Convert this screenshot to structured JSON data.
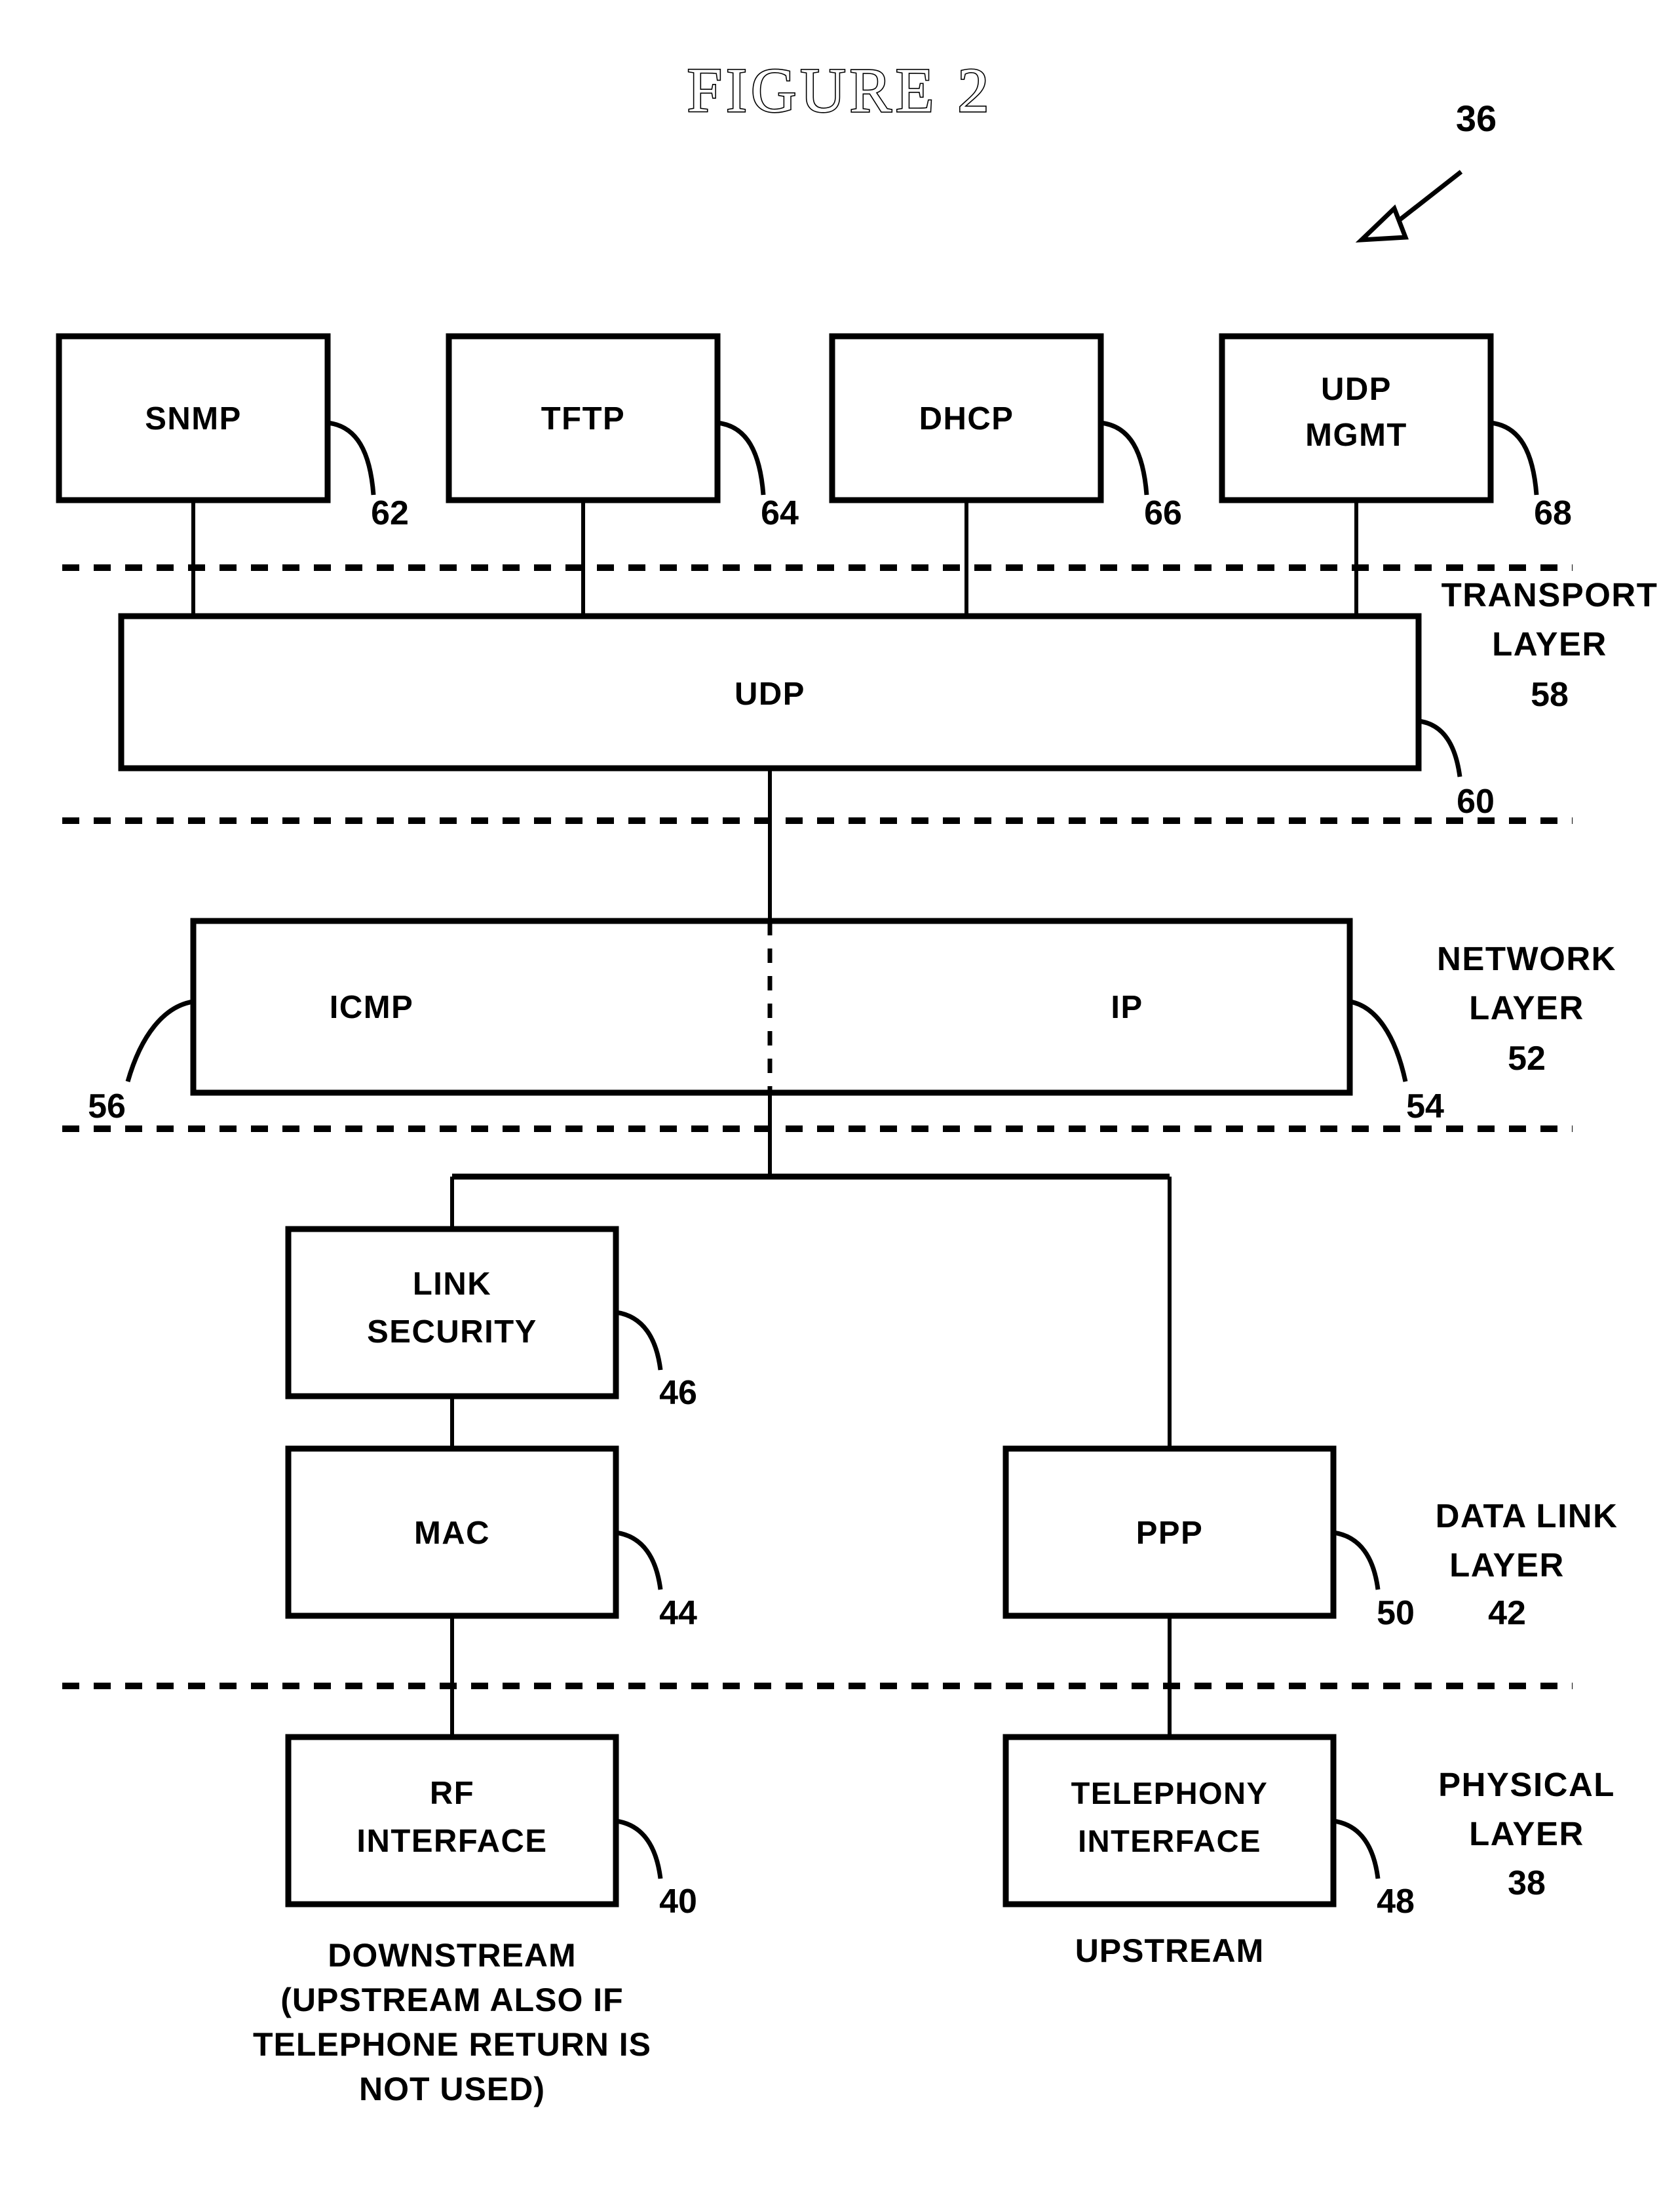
{
  "figure": {
    "title": "FIGURE 2",
    "overall_ref": "36"
  },
  "application_boxes": [
    {
      "label": "SNMP",
      "ref": "62"
    },
    {
      "label": "TFTP",
      "ref": "64"
    },
    {
      "label": "DHCP",
      "ref": "66"
    },
    {
      "label": "UDP",
      "label2": "MGMT",
      "ref": "68"
    }
  ],
  "transport": {
    "box_label": "UDP",
    "box_ref": "60",
    "layer_name_line1": "TRANSPORT",
    "layer_name_line2": "LAYER",
    "layer_ref": "58"
  },
  "network": {
    "left_label": "ICMP",
    "left_ref": "56",
    "right_label": "IP",
    "right_ref": "54",
    "layer_name_line1": "NETWORK",
    "layer_name_line2": "LAYER",
    "layer_ref": "52"
  },
  "datalink": {
    "link_security_line1": "LINK",
    "link_security_line2": "SECURITY",
    "link_security_ref": "46",
    "mac_label": "MAC",
    "mac_ref": "44",
    "ppp_label": "PPP",
    "ppp_ref": "50",
    "layer_name_line1": "DATA LINK",
    "layer_name_line2": "LAYER",
    "layer_ref": "42"
  },
  "physical": {
    "rf_line1": "RF",
    "rf_line2": "INTERFACE",
    "rf_ref": "40",
    "telephony_line1": "TELEPHONY",
    "telephony_line2": "INTERFACE",
    "telephony_ref": "48",
    "layer_name_line1": "PHYSICAL",
    "layer_name_line2": "LAYER",
    "layer_ref": "38"
  },
  "captions": {
    "downstream_line1": "DOWNSTREAM",
    "downstream_line2": "(UPSTREAM ALSO IF",
    "downstream_line3": "TELEPHONE RETURN IS",
    "downstream_line4": "NOT USED)",
    "upstream": "UPSTREAM"
  },
  "colors": {
    "ink": "#000000",
    "paper": "#ffffff"
  }
}
